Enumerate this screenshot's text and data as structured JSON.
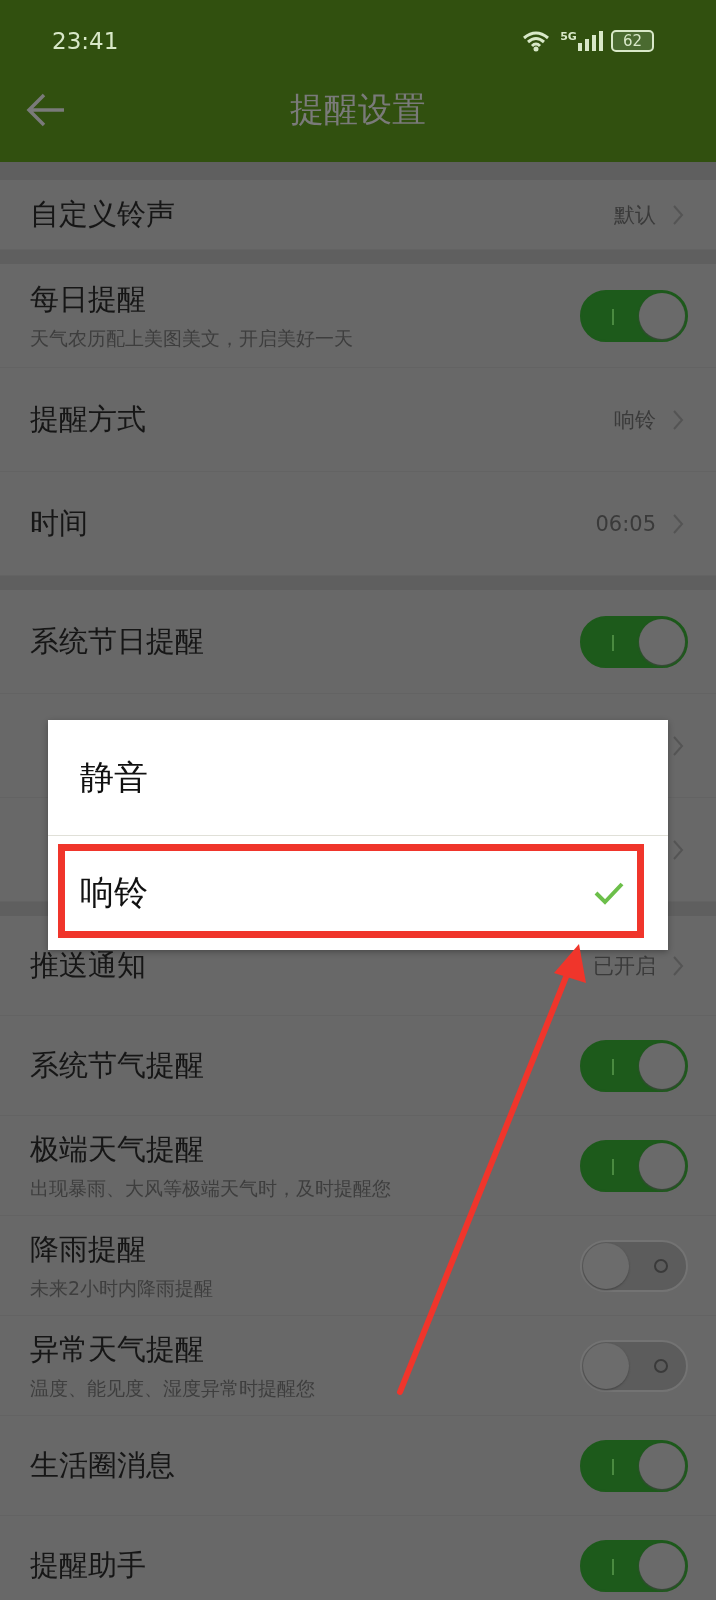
{
  "status_bar": {
    "time": "23:41",
    "network": "5G",
    "battery": "62"
  },
  "header": {
    "title": "提醒设置"
  },
  "sections": [
    {
      "rows": [
        {
          "kind": "value",
          "label": "自定义铃声",
          "value": "默认"
        }
      ]
    },
    {
      "rows": [
        {
          "kind": "toggle",
          "label": "每日提醒",
          "subtitle": "天气农历配上美图美文，开启美好一天",
          "on": true
        },
        {
          "kind": "value",
          "label": "提醒方式",
          "value": "响铃"
        },
        {
          "kind": "value",
          "label": "时间",
          "value": "06:05"
        }
      ]
    },
    {
      "rows": [
        {
          "kind": "toggle",
          "label": "系统节日提醒",
          "on": true
        },
        {
          "kind": "value"
        },
        {
          "kind": "value"
        }
      ]
    },
    {
      "rows": [
        {
          "kind": "value",
          "label": "推送通知",
          "value": "已开启"
        },
        {
          "kind": "toggle",
          "label": "系统节气提醒",
          "on": true
        },
        {
          "kind": "toggle",
          "label": "极端天气提醒",
          "subtitle": "出现暴雨、大风等极端天气时，及时提醒您",
          "on": true
        },
        {
          "kind": "toggle",
          "label": "降雨提醒",
          "subtitle": "未来2小时内降雨提醒",
          "on": false
        },
        {
          "kind": "toggle",
          "label": "异常天气提醒",
          "subtitle": "温度、能见度、湿度异常时提醒您",
          "on": false
        },
        {
          "kind": "toggle",
          "label": "生活圈消息",
          "on": true
        },
        {
          "kind": "toggle",
          "label": "提醒助手",
          "on": true
        }
      ]
    }
  ],
  "dialog": {
    "options": [
      {
        "label": "静音",
        "selected": false
      },
      {
        "label": "响铃",
        "selected": true
      }
    ]
  }
}
